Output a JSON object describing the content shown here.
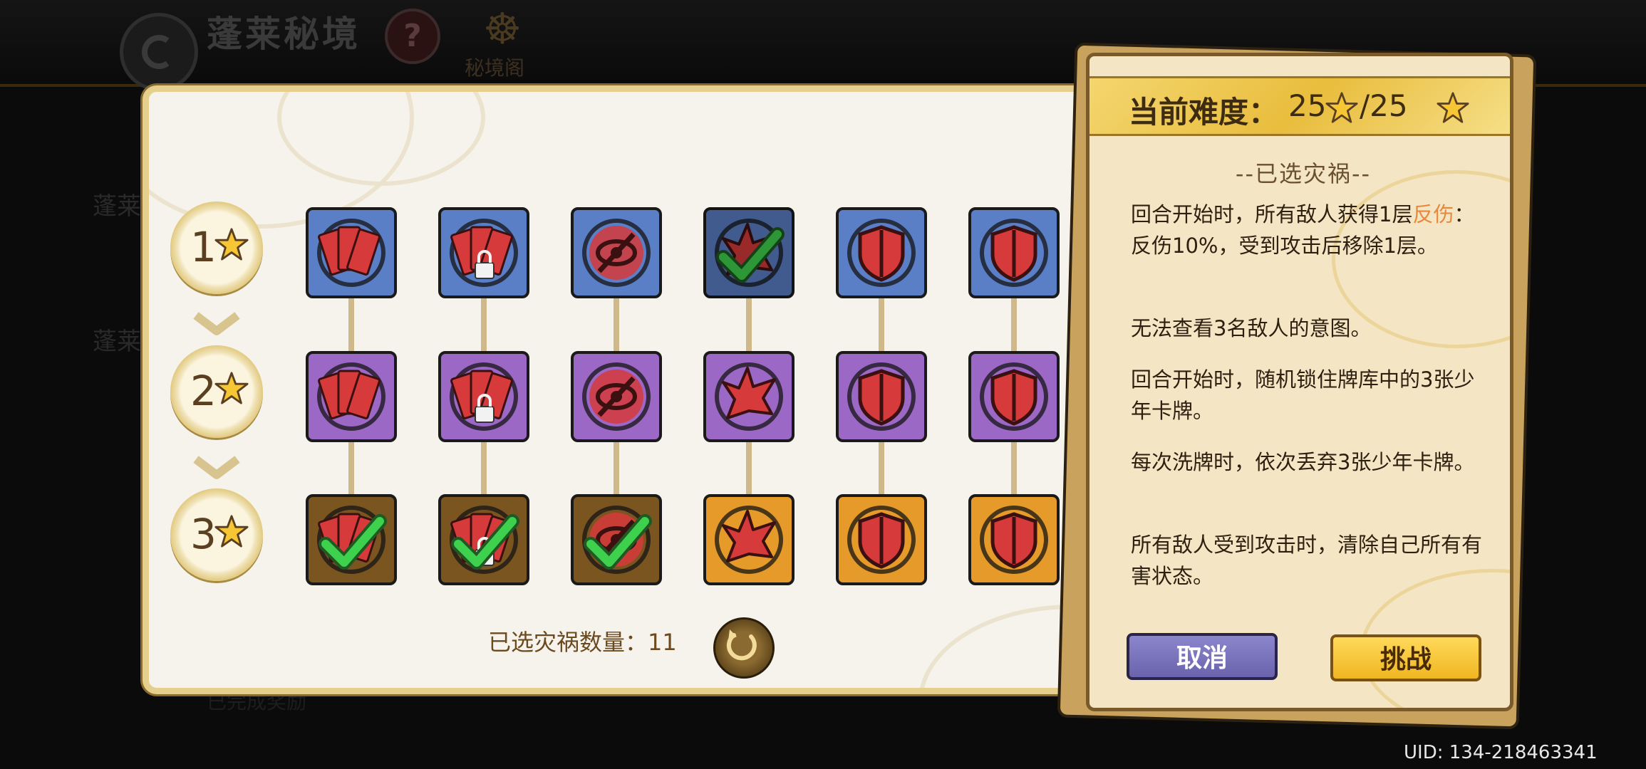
{
  "header": {
    "title": "蓬莱秘境",
    "help_icon": "question-icon",
    "realm_label": "秘境阁"
  },
  "background": {
    "side_text_1": "蓬莱",
    "side_text_2": "蓬莱",
    "bottom_text": "已完成奖励"
  },
  "rows": [
    {
      "label": "1",
      "star": "star-icon"
    },
    {
      "label": "2",
      "star": "star-icon"
    },
    {
      "label": "3",
      "star": "star-icon"
    }
  ],
  "grid": [
    [
      {
        "icon": "cards-icon",
        "color": "blue",
        "checked": false,
        "locked": false
      },
      {
        "icon": "cards-lock-icon",
        "color": "blue",
        "checked": false,
        "locked": true
      },
      {
        "icon": "blind-eye-icon",
        "color": "blue",
        "checked": false,
        "locked": false
      },
      {
        "icon": "spiked-shell-icon",
        "color": "blue",
        "checked": true,
        "locked": false
      },
      {
        "icon": "shield-icon",
        "color": "blue",
        "checked": false,
        "locked": false
      },
      {
        "icon": "shield-icon",
        "color": "blue",
        "checked": false,
        "locked": false
      }
    ],
    [
      {
        "icon": "cards-icon",
        "color": "purple",
        "checked": false,
        "locked": false
      },
      {
        "icon": "cards-lock-icon",
        "color": "purple",
        "checked": false,
        "locked": true
      },
      {
        "icon": "blind-eye-icon",
        "color": "purple",
        "checked": false,
        "locked": false
      },
      {
        "icon": "spiked-shell-icon",
        "color": "purple",
        "checked": false,
        "locked": false
      },
      {
        "icon": "shield-icon",
        "color": "purple",
        "checked": false,
        "locked": false
      },
      {
        "icon": "shield-icon",
        "color": "purple",
        "checked": false,
        "locked": false
      }
    ],
    [
      {
        "icon": "cards-icon",
        "color": "brown",
        "checked": true,
        "locked": false
      },
      {
        "icon": "cards-lock-icon",
        "color": "brown",
        "checked": true,
        "locked": false
      },
      {
        "icon": "blind-eye-icon",
        "color": "brown",
        "checked": true,
        "locked": false
      },
      {
        "icon": "spiked-shell-icon",
        "color": "orange",
        "checked": false,
        "locked": false
      },
      {
        "icon": "shield-icon",
        "color": "orange",
        "checked": false,
        "locked": false
      },
      {
        "icon": "shield-icon",
        "color": "orange",
        "checked": false,
        "locked": false
      }
    ]
  ],
  "count_label": "已选灾祸数量：11",
  "reset_icon": "reset-icon",
  "card": {
    "difficulty_label": "当前难度：",
    "difficulty_current": "25",
    "difficulty_max": "/25",
    "section_title": "--已选灾祸--",
    "effects": [
      {
        "pre": "回合开始时，所有敌人获得1层",
        "hl": "反伤",
        "post": "：反伤10%，受到攻击后移除1层。"
      },
      {
        "pre": "无法查看3名敌人的意图。",
        "hl": "",
        "post": ""
      },
      {
        "pre": "回合开始时，随机锁住牌库中的3张少年卡牌。",
        "hl": "",
        "post": ""
      },
      {
        "pre": "每次洗牌时，依次丢弃3张少年卡牌。",
        "hl": "",
        "post": ""
      },
      {
        "pre": "所有敌人受到攻击时，清除自己所有有害状态。",
        "hl": "",
        "post": ""
      }
    ],
    "cancel_label": "取消",
    "challenge_label": "挑战"
  },
  "uid": "UID: 134-218463341",
  "colors": {
    "blue": "#5b7fc7",
    "purple": "#9c68c6",
    "brown": "#7b5520",
    "orange": "#e59a2a",
    "highlight": "#e9883a"
  }
}
